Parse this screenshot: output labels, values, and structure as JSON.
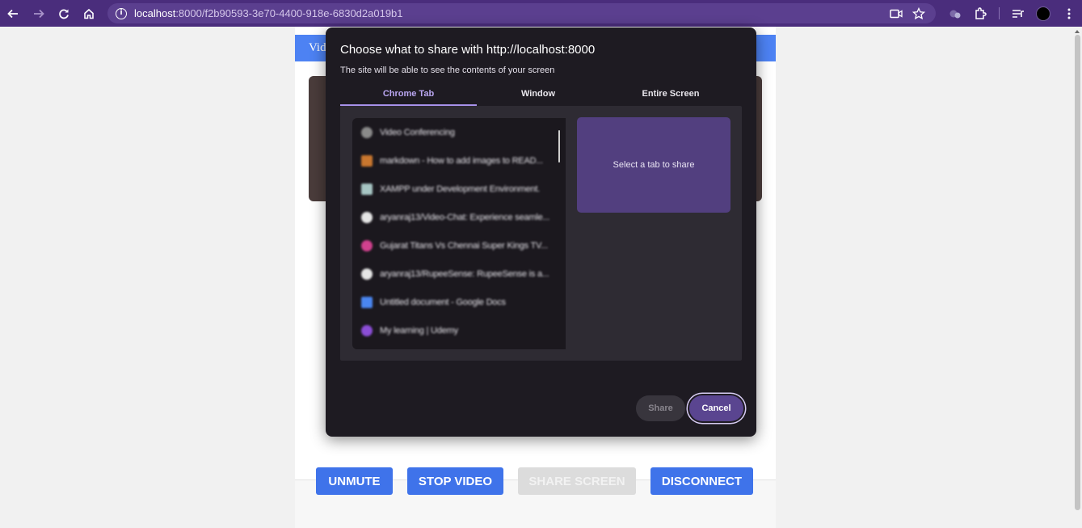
{
  "browser": {
    "url_host": "localhost",
    "url_path": ":8000/f2b90593-3e70-4400-918e-6830d2a019b1",
    "toolbar_icons": [
      "back-icon",
      "forward-icon",
      "reload-icon",
      "home-icon",
      "site-info-icon",
      "camera-icon",
      "star-icon",
      "extension-puzzle-icon",
      "media-queue-icon",
      "profile-avatar",
      "menu-icon"
    ]
  },
  "app": {
    "header_title": "Vid",
    "buttons": {
      "unmute": "UNMUTE",
      "stop_video": "STOP VIDEO",
      "share_screen": "SHARE SCREEN",
      "disconnect": "DISCONNECT"
    }
  },
  "dialog": {
    "title": "Choose what to share with http://localhost:8000",
    "subtitle": "The site will be able to see the contents of your screen",
    "tabs": [
      {
        "label": "Chrome Tab",
        "active": true
      },
      {
        "label": "Window",
        "active": false
      },
      {
        "label": "Entire Screen",
        "active": false
      }
    ],
    "tab_list": [
      {
        "label": "Video Conferencing",
        "icon": "globe-icon"
      },
      {
        "label": "markdown - How to add images to READ...",
        "icon": "stackoverflow-icon"
      },
      {
        "label": "XAMPP under Development Environment.",
        "icon": "page-icon"
      },
      {
        "label": "aryanraj13/Video-Chat: Experience seamle...",
        "icon": "github-icon"
      },
      {
        "label": "Gujarat Titans Vs Chennai Super Kings TV...",
        "icon": "cricket-icon"
      },
      {
        "label": "aryanraj13/RupeeSense: RupeeSense is a...",
        "icon": "github-icon"
      },
      {
        "label": "Untitled document - Google Docs",
        "icon": "docs-icon"
      },
      {
        "label": "My learning | Udemy",
        "icon": "udemy-icon"
      }
    ],
    "preview_text": "Select a tab to share",
    "share_label": "Share",
    "cancel_label": "Cancel"
  },
  "colors": {
    "browser_frame": "#4a2d7c",
    "app_accent": "#4d82f3",
    "dialog_bg": "#1e1b22",
    "dialog_accent": "#a892ea"
  }
}
